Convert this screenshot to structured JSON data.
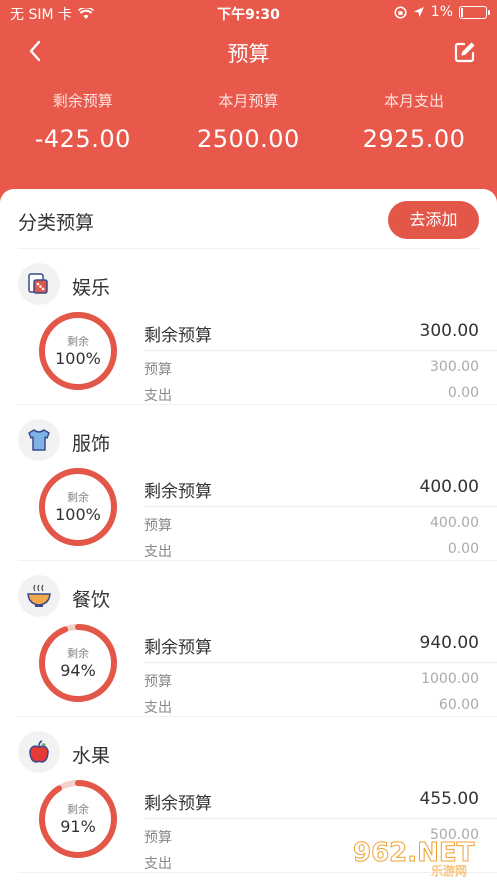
{
  "status": {
    "carrier": "无 SIM 卡",
    "time": "下午9:30",
    "battery": "1%"
  },
  "nav": {
    "title": "预算"
  },
  "summary": [
    {
      "label": "剩余预算",
      "value": "-425.00"
    },
    {
      "label": "本月预算",
      "value": "2500.00"
    },
    {
      "label": "本月支出",
      "value": "2925.00"
    }
  ],
  "section": {
    "title": "分类预算",
    "add_label": "去添加"
  },
  "colors": {
    "accent": "#e9594b",
    "ring": "#e35749",
    "ring_track": "#f3d0cc"
  },
  "categories": [
    {
      "name": "娱乐",
      "icon": "dice-cards-icon",
      "ring_label": "剩余",
      "percent_text": "100%",
      "percent": 1.0,
      "remain_label": "剩余预算",
      "remain": "300.00",
      "budget_label": "预算",
      "budget": "300.00",
      "spend_label": "支出",
      "spend": "0.00"
    },
    {
      "name": "服饰",
      "icon": "tshirt-icon",
      "ring_label": "剩余",
      "percent_text": "100%",
      "percent": 1.0,
      "remain_label": "剩余预算",
      "remain": "400.00",
      "budget_label": "预算",
      "budget": "400.00",
      "spend_label": "支出",
      "spend": "0.00"
    },
    {
      "name": "餐饮",
      "icon": "bowl-icon",
      "ring_label": "剩余",
      "percent_text": "94%",
      "percent": 0.94,
      "remain_label": "剩余预算",
      "remain": "940.00",
      "budget_label": "预算",
      "budget": "1000.00",
      "spend_label": "支出",
      "spend": "60.00"
    },
    {
      "name": "水果",
      "icon": "apple-icon",
      "ring_label": "剩余",
      "percent_text": "91%",
      "percent": 0.91,
      "remain_label": "剩余预算",
      "remain": "455.00",
      "budget_label": "预算",
      "budget": "500.00",
      "spend_label": "支出",
      "spend": ""
    }
  ],
  "watermark": {
    "text": "962.NET",
    "sub": "乐游网"
  }
}
